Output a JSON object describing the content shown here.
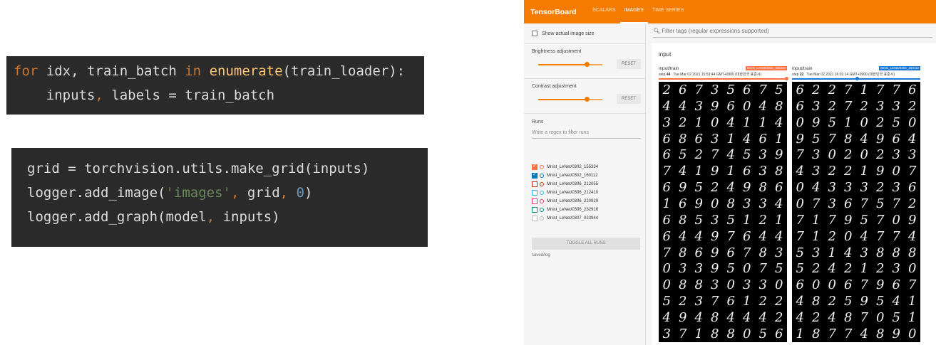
{
  "code_block_1": {
    "line1": {
      "kw_for": "for",
      "a": " idx, train_batch ",
      "kw_in": "in",
      "b": " ",
      "fn": "enumerate",
      "c": "(train_loader):"
    },
    "line2": {
      "a": "    inputs",
      "comma": ",",
      "b": " labels = train_batch"
    }
  },
  "code_block_2": {
    "line1": "grid = torchvision.utils.make_grid(inputs)",
    "line2": {
      "a": "logger.add_image(",
      "str": "'images'",
      "comma": ",",
      "b": " grid",
      "comma2": ",",
      "c": " ",
      "num": "0",
      "d": ")"
    },
    "line3": {
      "a": "logger.add_graph(model",
      "comma": ",",
      "b": " inputs)"
    }
  },
  "tensorboard": {
    "brand": "TensorBoard",
    "tabs": [
      "SCALARS",
      "IMAGES",
      "TIME SERIES"
    ],
    "active_tab": "IMAGES",
    "show_actual_size_label": "Show actual image size",
    "brightness_label": "Brightness adjustment",
    "brightness_level": 0.75,
    "contrast_label": "Contrast adjustment",
    "contrast_level": 0.75,
    "reset_label": "RESET",
    "runs_label": "Runs",
    "runs_filter_placeholder": "Write a regex to filter runs",
    "runs": [
      {
        "name": "Mnist_LeNet/0302_155334",
        "checked": true,
        "color": "#ff7043"
      },
      {
        "name": "Mnist_LeNet/0302_160112",
        "checked": true,
        "color": "#0077bb"
      },
      {
        "name": "Mnist_LeNet/0306_212055",
        "checked": false,
        "color": "#cc3311"
      },
      {
        "name": "Mnist_LeNet/0306_212410",
        "checked": false,
        "color": "#33bbee"
      },
      {
        "name": "Mnist_LeNet/0306_220929",
        "checked": false,
        "color": "#ee3377"
      },
      {
        "name": "Mnist_LeNet/0306_232916",
        "checked": false,
        "color": "#009988"
      },
      {
        "name": "Mnist_LeNet/0307_023944",
        "checked": false,
        "color": "#bbbbbb"
      }
    ],
    "toggle_all_label": "TOGGLE ALL RUNS",
    "log_dir": "saved/log",
    "filter_tags_placeholder": "Filter tags (regular expressions supported)",
    "panel_title": "input",
    "cards": [
      {
        "tag": "input/train",
        "step_label": "step",
        "step": "44",
        "time": "Tue Mar 02 2021 15:53:44 GMT+0900 (대한민국 표준시)",
        "run_badge": "Mnist_LeNet/0302_155334",
        "badge_color": "#ff7043",
        "slider_level": 1.0,
        "digits": [
          "26735675",
          "44396048",
          "32104114",
          "68631461",
          "65274539",
          "74191638",
          "69524986",
          "16908334",
          "68535121",
          "64497644",
          "78696783",
          "03395075",
          "08830330",
          "52376122",
          "49484442",
          "37188056"
        ]
      },
      {
        "tag": "input/train",
        "step_label": "step",
        "step": "22",
        "time": "Tue Mar 02 2021 16:01:14 GMT+0900 (대한민국 표준시)",
        "run_badge": "Mnist_LeNet/0302_160112",
        "badge_color": "#1976d2",
        "slider_level": 0.5,
        "digits": [
          "62271776",
          "63272332",
          "09510250",
          "95784964",
          "73020233",
          "43221907",
          "04333236",
          "07367572",
          "71795709",
          "71204774",
          "53143888",
          "52421230",
          "60067967",
          "48259541",
          "42487051",
          "18774890"
        ]
      }
    ]
  }
}
